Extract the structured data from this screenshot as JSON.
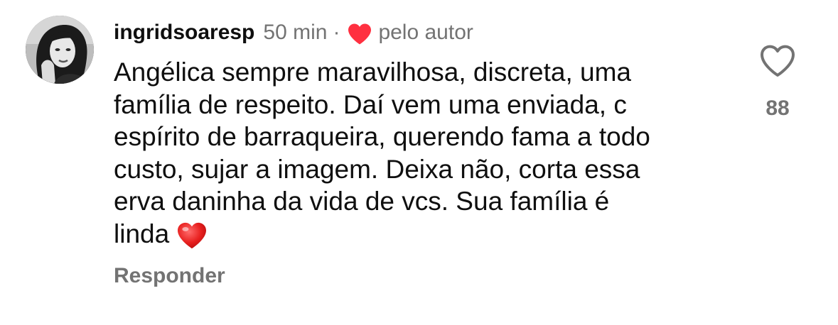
{
  "comment": {
    "username": "ingridsoaresp",
    "time": "50 min",
    "separator": "·",
    "liked_by_author_label": "pelo autor",
    "text_lines": "Angélica sempre maravilhosa, discreta, uma\nfamília de respeito. Daí vem uma enviada, c\nespírito de barraqueira, querendo fama a todo\ncusto, sujar a imagem. Deixa não, corta essa\nerva daninha da vida de vcs. Sua família é\nlinda",
    "inline_emoji": "red-heart-emoji",
    "reply_label": "Responder",
    "like_count": "88",
    "like_icon": "heart-outline-icon"
  },
  "colors": {
    "text": "#0f0f0f",
    "muted": "#737373",
    "heart_red": "#ff3040",
    "background": "#ffffff"
  }
}
